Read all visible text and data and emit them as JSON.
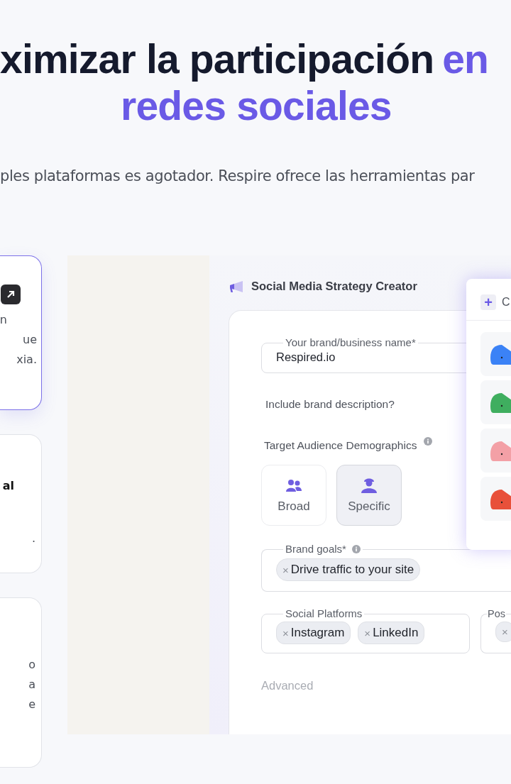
{
  "headline": {
    "line_1": "ximizar la participación",
    "line_1_accent": "en",
    "line_2": "redes sociales"
  },
  "subtitle": "ples plataformas es agotador. Respire ofrece las herramientas par",
  "feature_cards": [
    {
      "selected": true,
      "texts": [
        "n",
        "ue",
        "xia."
      ]
    },
    {
      "selected": false,
      "title": "al",
      "texts": [
        "."
      ]
    },
    {
      "selected": false,
      "texts": [
        "o",
        "a",
        "e"
      ]
    }
  ],
  "app": {
    "title": "Social Media Strategy Creator",
    "form": [
      {
        "kind": "text",
        "label": "Your brand/business name*",
        "value": "Respired.io"
      },
      {
        "kind": "question",
        "label": "Include brand description?"
      },
      {
        "kind": "choice",
        "label": "Target Audience Demographics",
        "info": true,
        "options": [
          {
            "label": "Broad",
            "selected": false
          },
          {
            "label": "Specific",
            "selected": true
          }
        ]
      },
      {
        "kind": "tags",
        "label": "Brand goals*",
        "info": true,
        "tags": [
          {
            "remove": "×",
            "label": "Drive traffic to your site"
          }
        ]
      },
      {
        "kind": "tag_row",
        "fields": [
          {
            "label": "Social Platforms",
            "tags": [
              {
                "remove": "×",
                "label": "Instagram"
              },
              {
                "remove": "×",
                "label": "LinkedIn"
              }
            ]
          },
          {
            "label": "Pos",
            "tags": [
              {
                "remove": "×"
              }
            ]
          }
        ]
      },
      {
        "kind": "link",
        "label": "Advanced"
      }
    ],
    "popup": {
      "add": "+",
      "label": "C",
      "items": [
        {
          "color": "#3b82f6"
        },
        {
          "color": "#3fae5f"
        },
        {
          "color": "#f3a0a6"
        },
        {
          "color": "#e8503a"
        }
      ]
    }
  }
}
